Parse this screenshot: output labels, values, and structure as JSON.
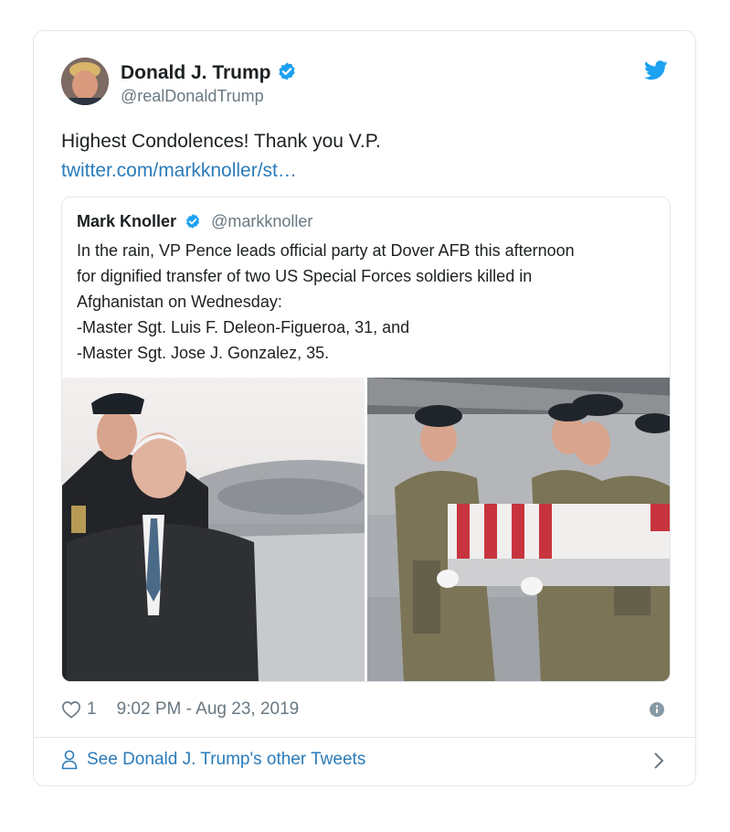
{
  "tweet": {
    "author_name": "Donald J. Trump",
    "author_handle": "@realDonaldTrump",
    "text": "Highest Condolences! Thank you V.P.",
    "link": "twitter.com/markknoller/st…",
    "likes": "1",
    "timestamp": "9:02 PM - Aug 23, 2019",
    "footer_label": "See Donald J. Trump's other Tweets"
  },
  "quoted": {
    "author_name": "Mark Knoller",
    "author_handle": "@markknoller",
    "lines": [
      "In the rain, VP Pence leads official party at Dover AFB this afternoon",
      "for dignified transfer of two US Special Forces soldiers killed in",
      "Afghanistan on Wednesday:",
      "-Master Sgt. Luis F. Deleon-Figueroa, 31, and",
      "-Master Sgt. Jose J. Gonzalez, 35."
    ]
  },
  "icons": {
    "verified": "verified-badge-icon",
    "bird": "twitter-bird-icon",
    "heart": "heart-icon",
    "info": "info-icon",
    "person": "person-icon",
    "chevron": "chevron-right-icon"
  },
  "colors": {
    "link": "#2b7bb9",
    "verified": "#1da1f2",
    "muted": "#697882",
    "border": "#e1e8ed"
  }
}
